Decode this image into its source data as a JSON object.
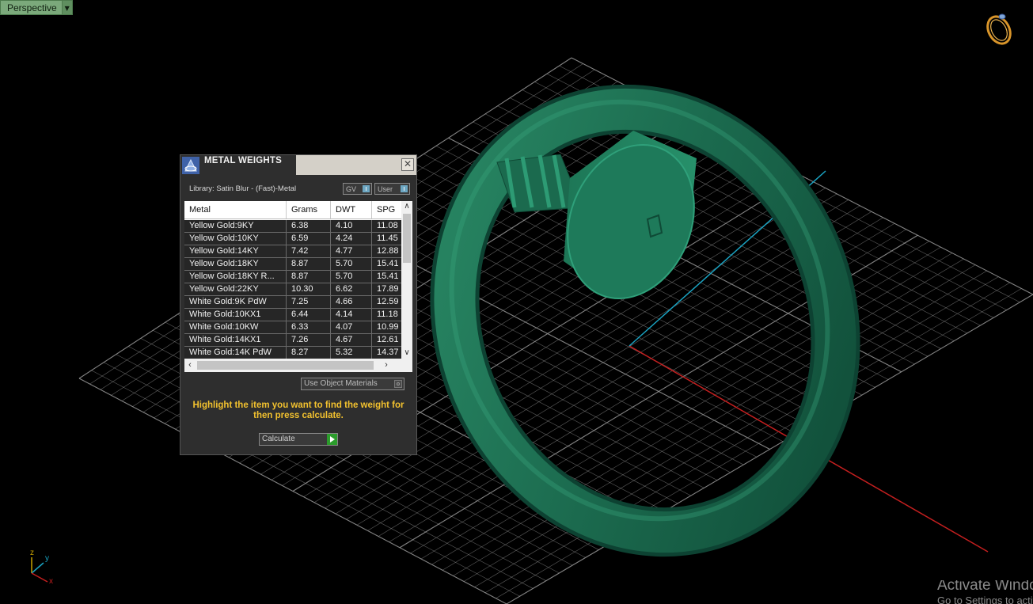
{
  "viewport": {
    "label": "Perspective",
    "axis_labels": {
      "z": "z",
      "y": "y",
      "x": "x"
    },
    "colors": {
      "grid": "#9a9a9a",
      "ring": "#1e6b4f",
      "x_axis": "#c41f1f",
      "y_axis": "#1aa3c2",
      "background": "#000000"
    },
    "icons": {
      "gizmo": "ring-navigation-icon",
      "dropdown": "dropdown-arrow-icon"
    }
  },
  "panel": {
    "title": "METAL WEIGHTS",
    "close_symbol": "✕",
    "library": "Library: Satin Blur - (Fast)-Metal",
    "toggle_gv": "GV",
    "toggle_user": "User",
    "columns": [
      "Metal",
      "Grams",
      "DWT",
      "SPG"
    ],
    "rows": [
      [
        "Yellow Gold:9KY",
        "6.38",
        "4.10",
        "11.08"
      ],
      [
        "Yellow Gold:10KY",
        "6.59",
        "4.24",
        "11.45"
      ],
      [
        "Yellow Gold:14KY",
        "7.42",
        "4.77",
        "12.88"
      ],
      [
        "Yellow Gold:18KY",
        "8.87",
        "5.70",
        "15.41"
      ],
      [
        "Yellow Gold:18KY R...",
        "8.87",
        "5.70",
        "15.41"
      ],
      [
        "Yellow Gold:22KY",
        "10.30",
        "6.62",
        "17.89"
      ],
      [
        "White Gold:9K PdW",
        "7.25",
        "4.66",
        "12.59"
      ],
      [
        "White Gold:10KX1",
        "6.44",
        "4.14",
        "11.18"
      ],
      [
        "White Gold:10KW",
        "6.33",
        "4.07",
        "10.99"
      ],
      [
        "White Gold:14KX1",
        "7.26",
        "4.67",
        "12.61"
      ],
      [
        "White Gold:14K PdW",
        "8.27",
        "5.32",
        "14.37"
      ]
    ],
    "use_object_materials": "Use Object Materials",
    "hint": "Highlight the item you want to find the weight for then press calculate.",
    "calculate": "Calculate",
    "accent_color": "#f2c12e"
  },
  "watermark": {
    "line1": "Activate Windows",
    "line2": "Go to Settings to activate Windows."
  }
}
